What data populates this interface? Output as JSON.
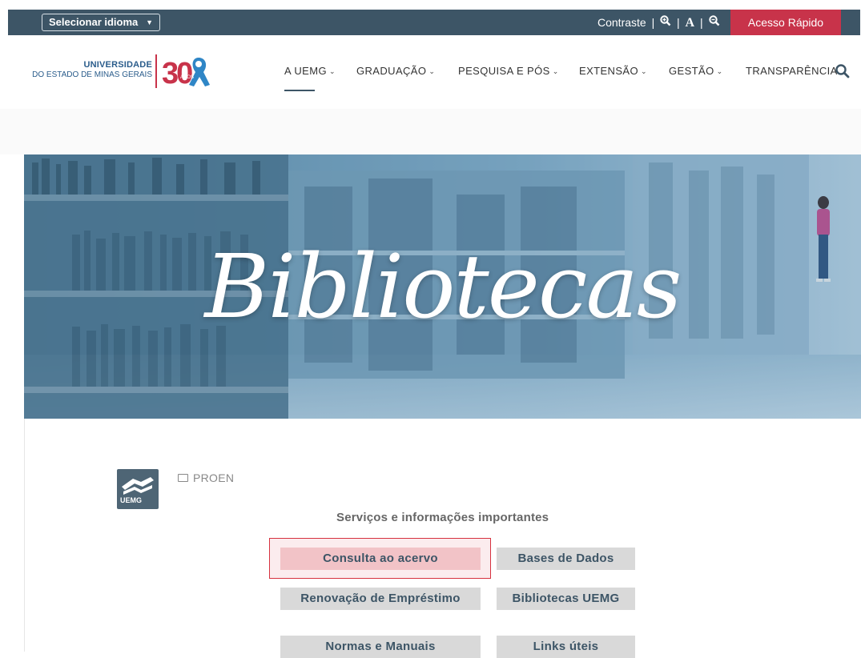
{
  "topbar": {
    "language_select": "Selecionar idioma",
    "contrast_label": "Contraste",
    "font_increase_icon": "zoom-in-icon",
    "font_label": "A",
    "font_decrease_icon": "zoom-out-icon",
    "quick_access": "Acesso Rápido",
    "colors": {
      "bar": "#3d5566",
      "quick_access": "#c8334a"
    }
  },
  "header": {
    "logo_line1": "UNIVERSIDADE",
    "logo_line2": "DO ESTADO DE MINAS GERAIS",
    "logo_badge": "30",
    "logo_badge_sub": "ANOS",
    "nav": [
      {
        "label": "A UEMG",
        "active": true
      },
      {
        "label": "GRADUAÇÃO"
      },
      {
        "label": "PESQUISA E PÓS"
      },
      {
        "label": "EXTENSÃO"
      },
      {
        "label": "GESTÃO"
      },
      {
        "label": "TRANSPARÊNCIA"
      }
    ],
    "search_icon": "search-icon"
  },
  "banner": {
    "title": "Bibliotecas"
  },
  "content": {
    "logo_text": "UEMG",
    "category": "PROEN",
    "section_title": "Serviços e informações importantes",
    "buttons": [
      "Consulta ao acervo",
      "Bases de Dados",
      "Renovação de Empréstimo",
      "Bibliotecas UEMG",
      "Normas e Manuais",
      "Links úteis"
    ]
  }
}
